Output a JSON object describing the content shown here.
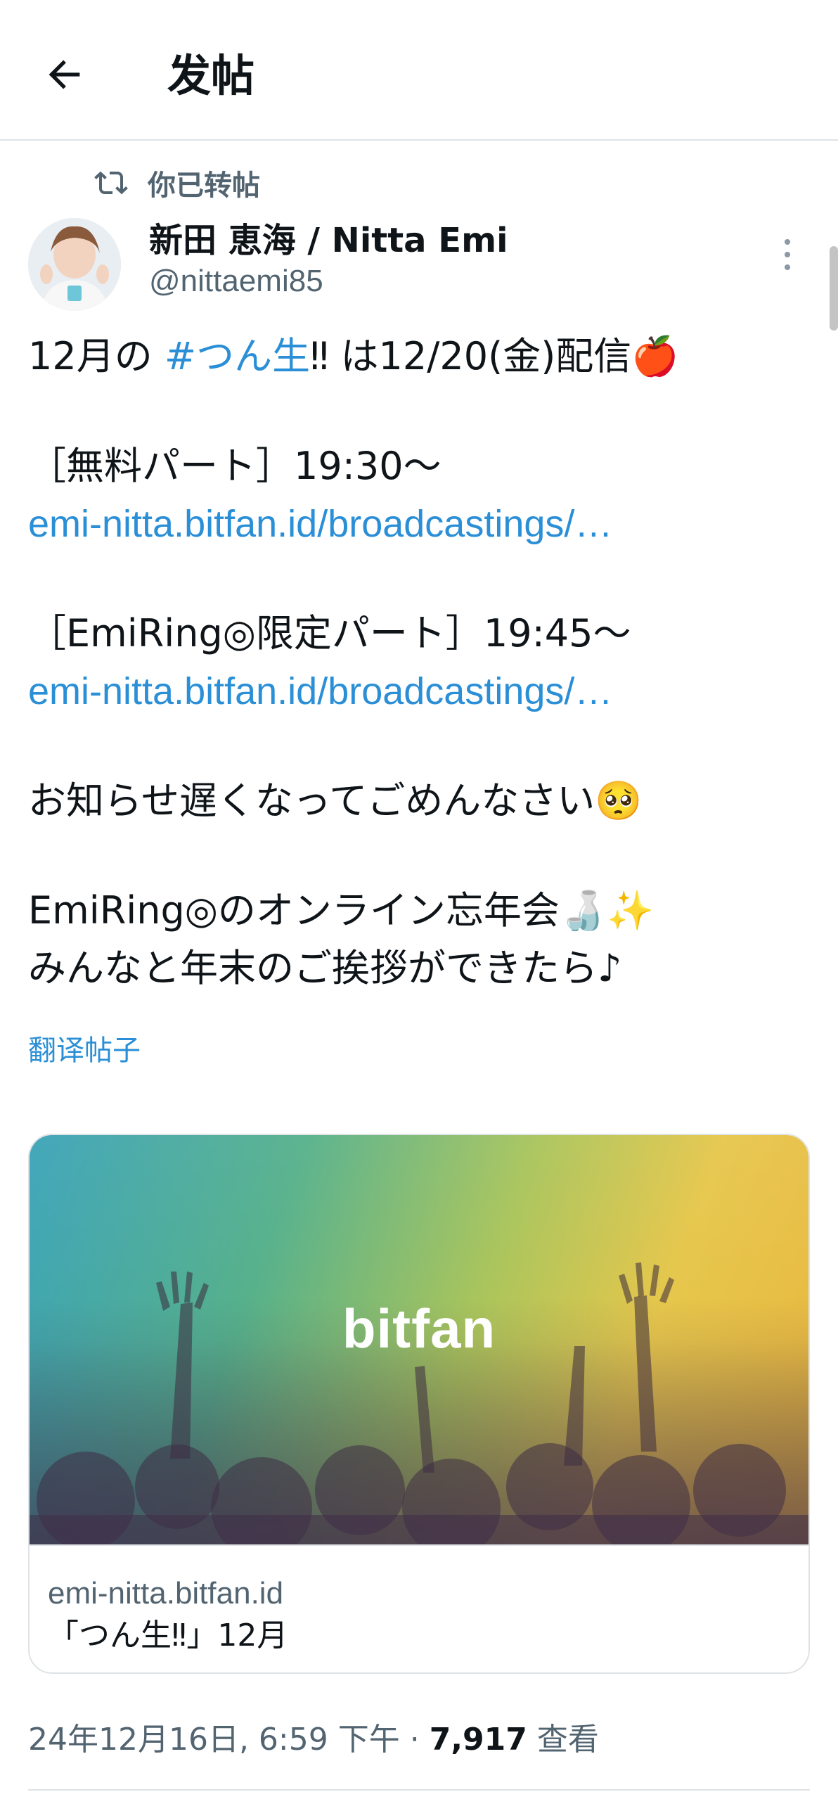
{
  "header": {
    "title": "发帖"
  },
  "repost": {
    "label": "你已转帖"
  },
  "author": {
    "display_name": "新田 恵海 / Nitta Emi",
    "handle": "@nittaemi85"
  },
  "tweet": {
    "line1_prefix": "12月の ",
    "hashtag": "#つん生",
    "line1_suffix": "‼ は12/20(金)配信🍎",
    "line2": "［無料パート］19:30〜",
    "link1": "emi-nitta.bitfan.id/broadcastings/…",
    "line3": "［EmiRing◎限定パート］19:45〜",
    "link2": "emi-nitta.bitfan.id/broadcastings/…",
    "line4": "お知らせ遅くなってごめんなさい🥺",
    "line5": "EmiRing◎のオンライン忘年会🍶✨",
    "line6": "みんなと年末のご挨拶ができたら♪"
  },
  "translate_label": "翻译帖子",
  "card": {
    "logo_text": "bitfan",
    "domain": "emi-nitta.bitfan.id",
    "title": "「つん生‼」12月"
  },
  "meta": {
    "timestamp": "24年12月16日, 6:59 下午 · ",
    "views_count": "7,917",
    "views_label": " 查看"
  },
  "colors": {
    "link": "#2a8fd6",
    "secondary_text": "#536471",
    "divider": "#dfe3e6"
  },
  "icons": {
    "back": "arrow-left-icon",
    "repost": "repost-icon",
    "more": "more-vertical-icon"
  }
}
